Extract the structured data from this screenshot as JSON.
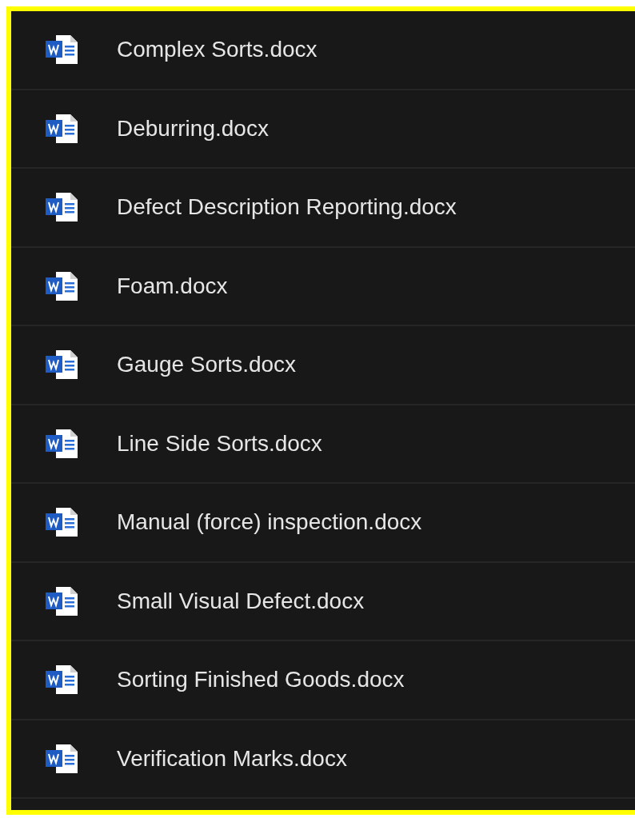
{
  "files": [
    {
      "name": "Complex Sorts.docx"
    },
    {
      "name": "Deburring.docx"
    },
    {
      "name": "Defect Description Reporting.docx"
    },
    {
      "name": "Foam.docx"
    },
    {
      "name": "Gauge Sorts.docx"
    },
    {
      "name": "Line Side Sorts.docx"
    },
    {
      "name": "Manual (force) inspection.docx"
    },
    {
      "name": "Small Visual Defect.docx"
    },
    {
      "name": "Sorting Finished Goods.docx"
    },
    {
      "name": "Verification Marks.docx"
    }
  ]
}
